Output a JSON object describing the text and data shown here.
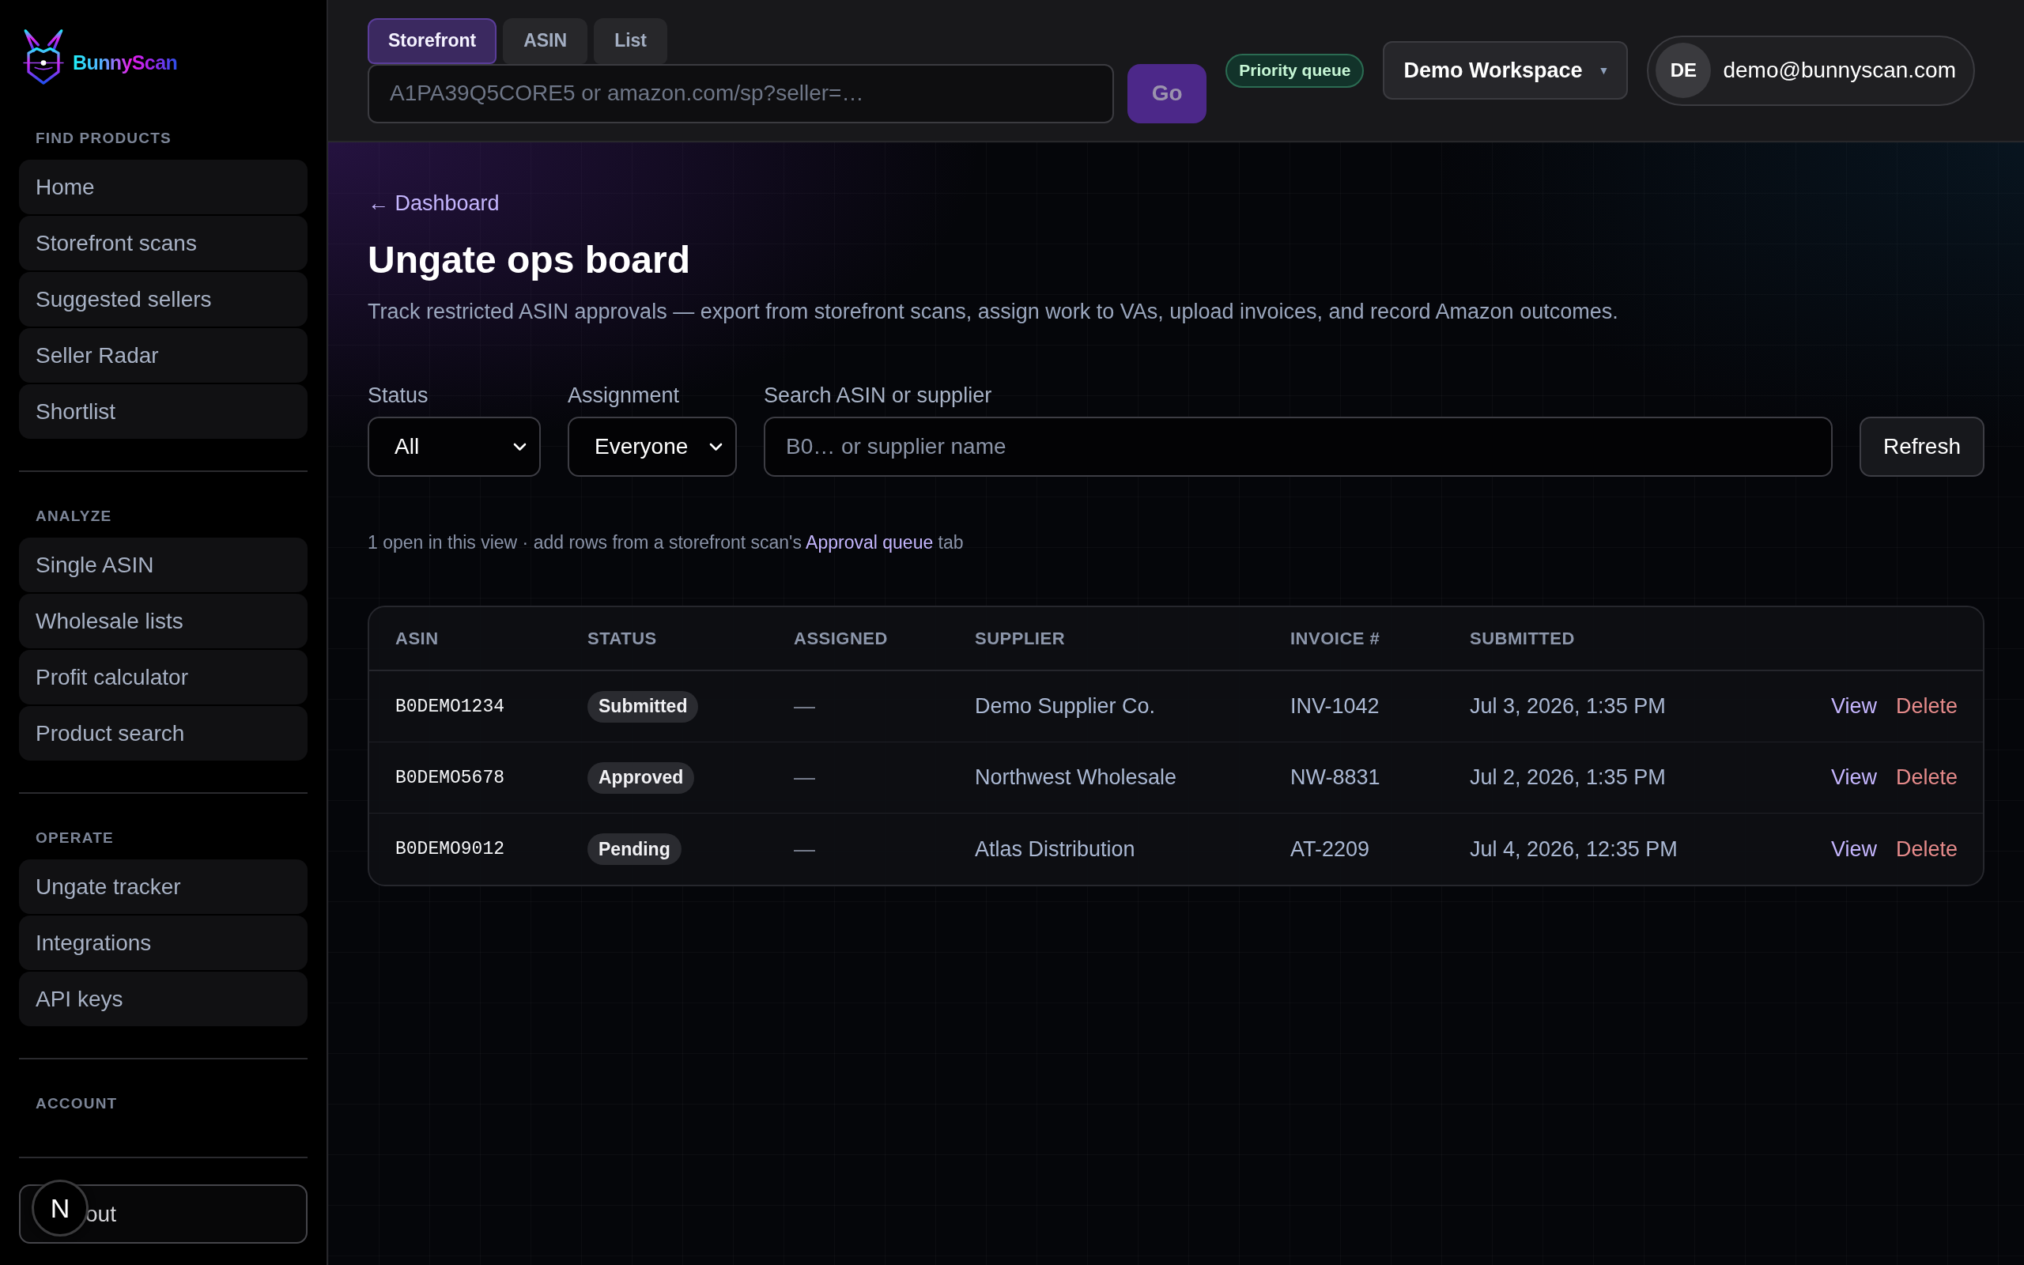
{
  "sidebar": {
    "brand": "BunnyScan",
    "sections": [
      {
        "title": "FIND PRODUCTS",
        "items": [
          "Home",
          "Storefront scans",
          "Suggested sellers",
          "Seller Radar",
          "Shortlist"
        ]
      },
      {
        "title": "ANALYZE",
        "items": [
          "Single ASIN",
          "Wholesale lists",
          "Profit calculator",
          "Product search"
        ]
      },
      {
        "title": "OPERATE",
        "items": [
          "Ungate tracker",
          "Integrations",
          "API keys"
        ]
      },
      {
        "title": "ACCOUNT"
      }
    ],
    "log_out": {
      "label": "out"
    }
  },
  "dev_badge": {
    "label": "N"
  },
  "topbar": {
    "tabs": [
      {
        "label": "Storefront",
        "selected": true
      },
      {
        "label": "ASIN",
        "selected": false
      },
      {
        "label": "List",
        "selected": false
      }
    ],
    "search": {
      "placeholder": "A1PA39Q5CORE5 or amazon.com/sp?seller=…"
    },
    "go_button": {
      "label": "Go",
      "disabled": true
    },
    "queue_badge": "Priority queue",
    "workspace": {
      "label": "Demo Workspace",
      "caret": "▼"
    },
    "user": {
      "initials": "DE",
      "email": "demo@bunnyscan.com"
    }
  },
  "page": {
    "back_link": "← Dashboard",
    "title": "Ungate ops board",
    "description": "Track restricted ASIN approvals — export from storefront scans, assign work to VAs, upload invoices, and record Amazon outcomes.",
    "filters": [
      {
        "kind": "select",
        "label": "Status",
        "value": "All"
      },
      {
        "kind": "select",
        "label": "Assignment",
        "value": "Everyone"
      },
      {
        "kind": "search",
        "label": "Search ASIN or supplier",
        "placeholder": "B0… or supplier name"
      }
    ],
    "refresh_button": "Refresh",
    "note": {
      "text": "1 open in this view · add rows from a storefront scan's",
      "link": "Approval queue",
      "after": "tab"
    }
  },
  "table": {
    "columns": [
      "ASIN",
      "STATUS",
      "ASSIGNED",
      "SUPPLIER",
      "INVOICE #",
      "SUBMITTED"
    ],
    "rows": [
      {
        "asin": "B0DEMO1234",
        "status": "Submitted",
        "assigned": "—",
        "supplier": "Demo Supplier Co.",
        "invoice": "INV-1042",
        "submitted": "Jul 3, 2026, 1:35 PM",
        "actions": [
          {
            "kind": "view",
            "label": "View"
          },
          {
            "kind": "delete",
            "label": "Delete"
          }
        ]
      },
      {
        "asin": "B0DEMO5678",
        "status": "Approved",
        "assigned": "—",
        "supplier": "Northwest Wholesale",
        "invoice": "NW-8831",
        "submitted": "Jul 2, 2026, 1:35 PM",
        "actions": [
          {
            "kind": "view",
            "label": "View"
          },
          {
            "kind": "delete",
            "label": "Delete"
          }
        ]
      },
      {
        "asin": "B0DEMO9012",
        "status": "Pending",
        "assigned": "—",
        "supplier": "Atlas Distribution",
        "invoice": "AT-2209",
        "submitted": "Jul 4, 2026, 12:35 PM",
        "actions": [
          {
            "kind": "view",
            "label": "View"
          },
          {
            "kind": "delete",
            "label": "Delete"
          }
        ]
      }
    ]
  }
}
